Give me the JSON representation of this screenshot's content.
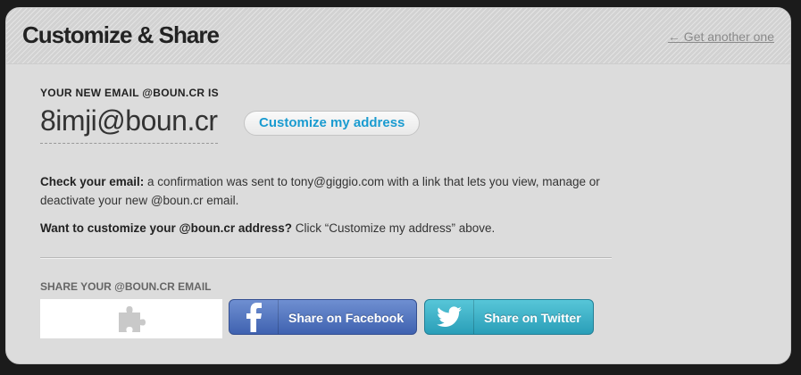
{
  "header": {
    "title": "Customize & Share",
    "back_link": "← Get another one"
  },
  "main": {
    "new_email_label": "YOUR NEW EMAIL @BOUN.CR IS",
    "email_address": "8imji@boun.cr",
    "customize_button": "Customize my address",
    "check_email": {
      "bold": "Check your email:",
      "text": " a confirmation was sent to tony@giggio.com with a link that lets you view, manage or deactivate your new @boun.cr email."
    },
    "want_customize": {
      "bold": "Want to customize your @boun.cr address?",
      "text": " Click “Customize my address” above."
    },
    "share_label": "SHARE YOUR @BOUN.CR EMAIL",
    "plugin_icon": "puzzle-piece-icon",
    "facebook_button": "Share on Facebook",
    "twitter_button": "Share on Twitter"
  },
  "colors": {
    "background": "#1b1b1b",
    "panel": "#dcdcdc",
    "link_accent": "#1a9bd0",
    "facebook": "#3f62b0",
    "twitter": "#2a9eb8"
  }
}
